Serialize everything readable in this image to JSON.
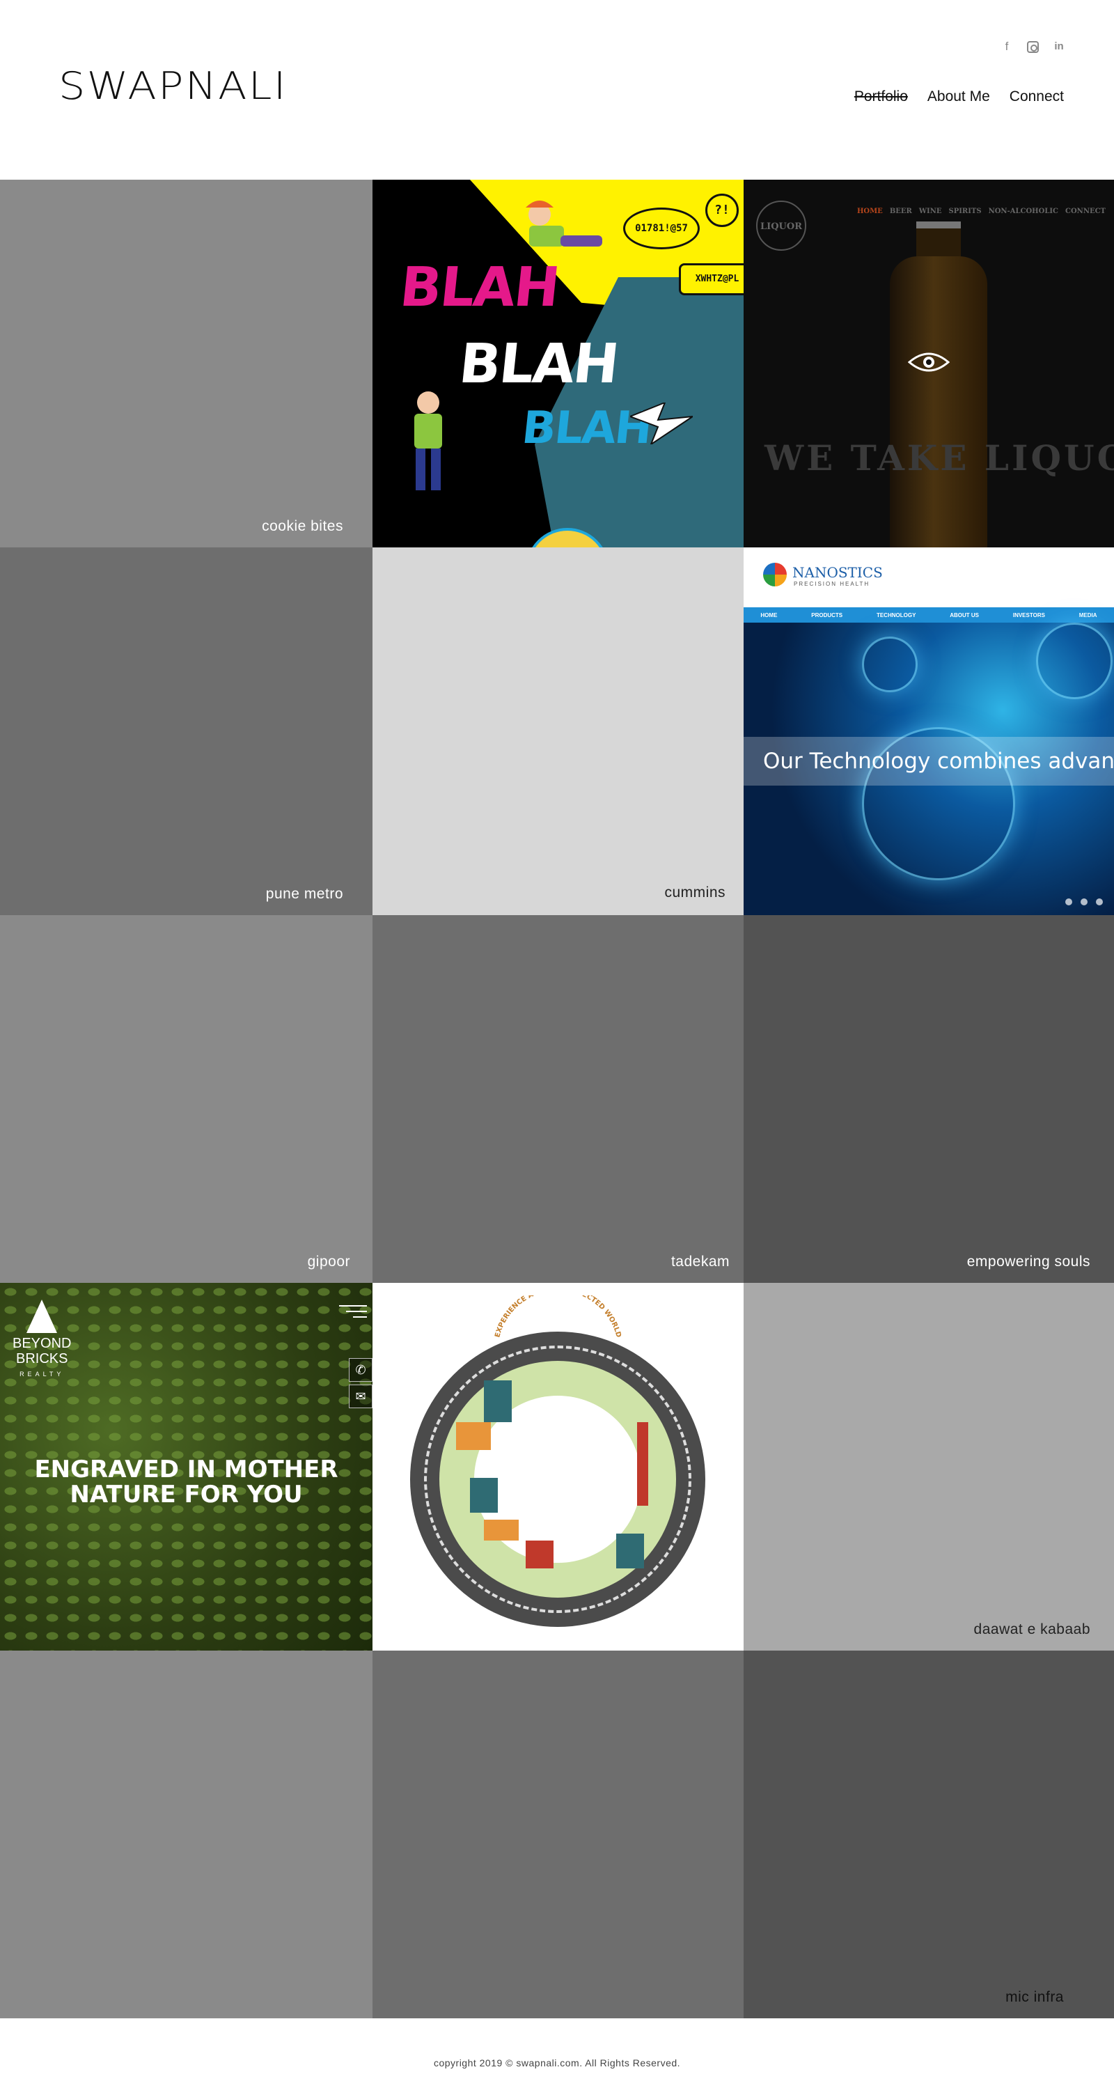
{
  "header": {
    "logo": "SWAPNALI",
    "social": [
      {
        "icon": "facebook-icon",
        "glyph": "f"
      },
      {
        "icon": "instagram-icon",
        "glyph": ""
      },
      {
        "icon": "linkedin-icon",
        "glyph": "in"
      }
    ],
    "nav": [
      {
        "label": "Portfolio",
        "active": true
      },
      {
        "label": "About Me",
        "active": false
      },
      {
        "label": "Connect",
        "active": false
      }
    ]
  },
  "portfolio": {
    "tiles": [
      {
        "label": "cookie bites",
        "kind": "gray"
      },
      {
        "label": "",
        "kind": "blah-blah"
      },
      {
        "label": "",
        "kind": "liquor-place"
      },
      {
        "label": "pune metro",
        "kind": "gray"
      },
      {
        "label": "cummins",
        "kind": "gray"
      },
      {
        "label": "",
        "kind": "nanostics"
      },
      {
        "label": "gipoor",
        "kind": "gray"
      },
      {
        "label": "tadekam",
        "kind": "gray"
      },
      {
        "label": "empowering souls",
        "kind": "gray"
      },
      {
        "label": "",
        "kind": "beyond-bricks"
      },
      {
        "label": "",
        "kind": "well-connected-world"
      },
      {
        "label": "daawat e kabaab",
        "kind": "gray"
      },
      {
        "label": "",
        "kind": "gray"
      },
      {
        "label": "",
        "kind": "gray"
      },
      {
        "label": "mic infra",
        "kind": "gray"
      }
    ],
    "blah": {
      "words": [
        "BLAH",
        "BLAH",
        "BLAH"
      ],
      "bubbles": [
        "01781!@57",
        "?!",
        "XWHTZ@PL"
      ]
    },
    "liquor": {
      "badge": "LIQUOR",
      "menu": [
        "HOME",
        "BEER",
        "WINE",
        "SPIRITS",
        "NON-ALCOHOLIC",
        "CONNECT"
      ],
      "headline": "WE TAKE LIQUO"
    },
    "nanostics": {
      "brand": "NANOSTICS",
      "tagline": "PRECISION HEALTH",
      "menu": [
        "HOME",
        "PRODUCTS",
        "TECHNOLOGY",
        "ABOUT US",
        "INVESTORS",
        "MEDIA"
      ],
      "caption": "Our Technology combines advanced"
    },
    "beyond_bricks": {
      "logo_line1": "BEYOND",
      "logo_line2": "BRICKS",
      "logo_line3": "REALTY",
      "headline_line1": "ENGRAVED IN MOTHER",
      "headline_line2": "NATURE FOR YOU"
    },
    "world": {
      "headline": "EXPERIENCE A WELL-CONNECTED WORLD"
    }
  },
  "footer": {
    "copyright": "copyright 2019 ©  swapnali.com. All Rights Reserved."
  },
  "colors": {
    "accent_strike": "#111111",
    "footer_text": "#444444"
  }
}
